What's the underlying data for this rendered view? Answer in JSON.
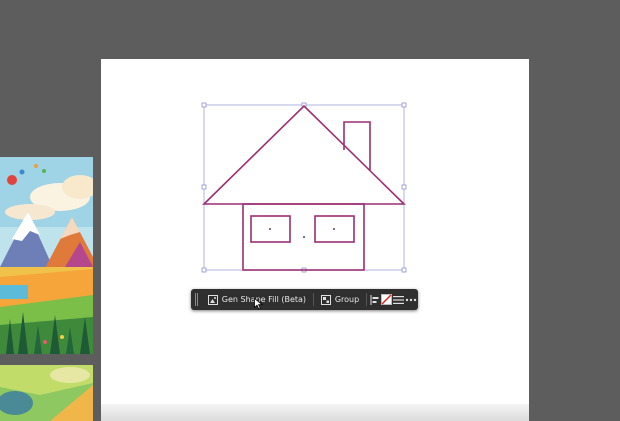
{
  "canvas": {
    "pasteboard_color": "#5d5d5d",
    "artboard_color": "#ffffff",
    "selection_color": "#8f8fd0",
    "stroke_color": "#9b2f72"
  },
  "thumbnails": [
    {
      "name": "mountain-landscape-illustration"
    },
    {
      "name": "landscape-illustration-partial"
    }
  ],
  "context_toolbar": {
    "gen_shape_fill_label": "Gen Shape Fill (Beta)",
    "group_label": "Group",
    "icons": [
      "gen-shape-fill-icon",
      "group-icon",
      "align-icon",
      "fill-stroke-icon",
      "lines-icon",
      "more-icon"
    ]
  }
}
